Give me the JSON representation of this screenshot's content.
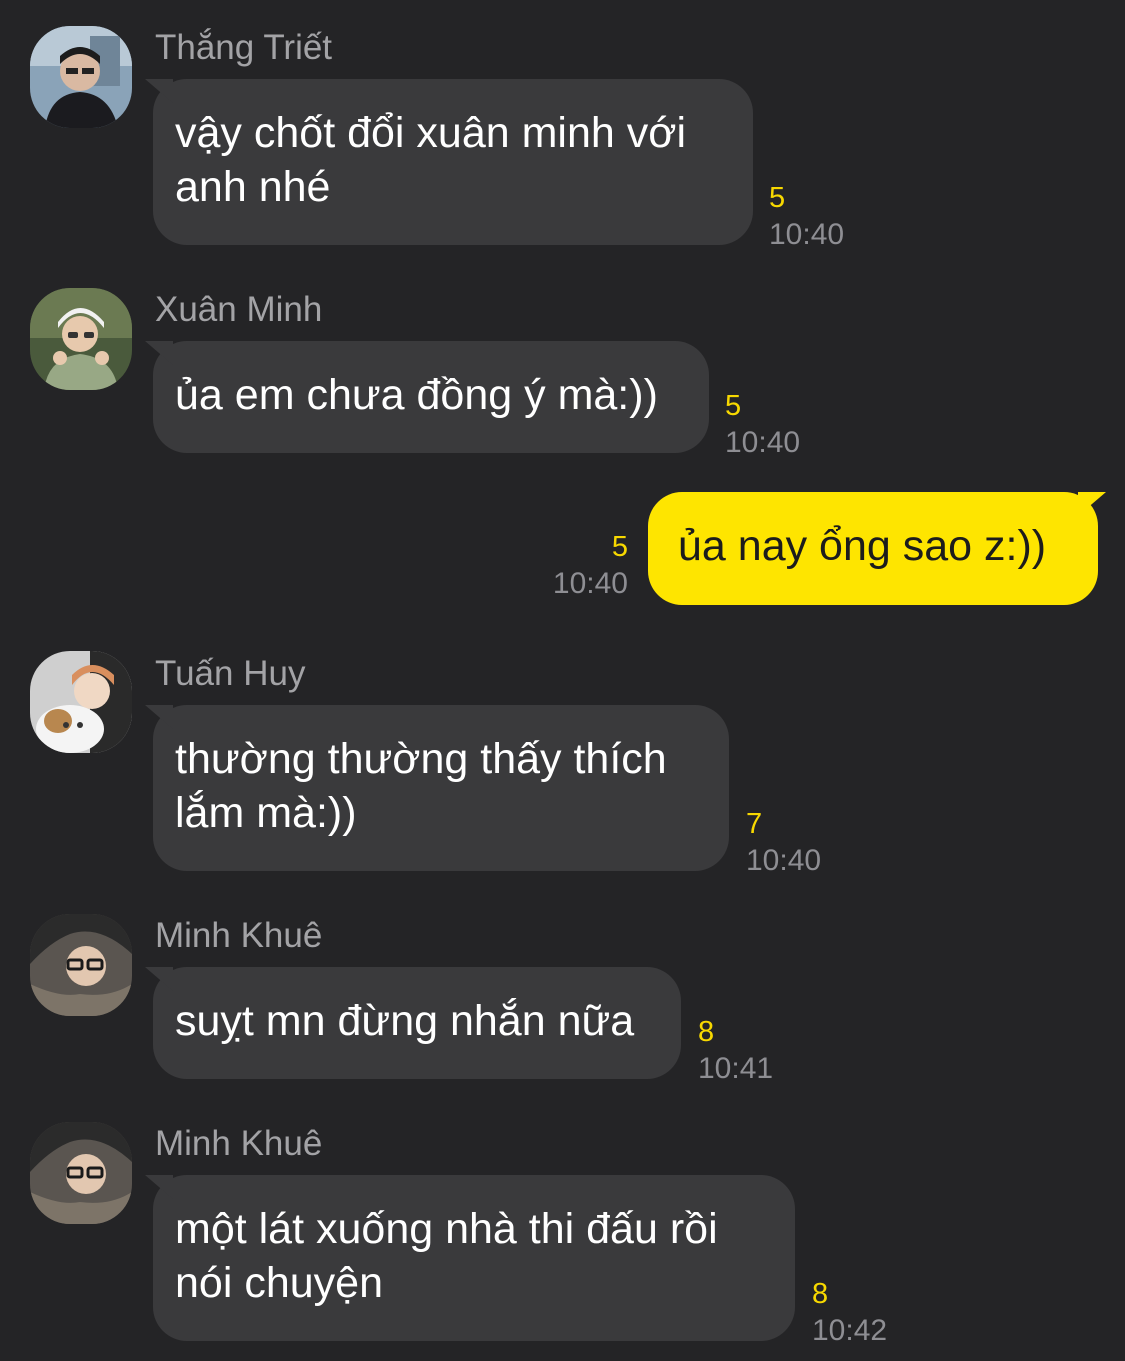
{
  "messages": [
    {
      "sender": "Thắng Triết",
      "avatar_icon": "avatar-thang-triet",
      "lines": [
        "vậy chốt đổi xuân minh với",
        "anh nhé"
      ],
      "unread": "5",
      "time": "10:40",
      "mine": false
    },
    {
      "sender": "Xuân Minh",
      "avatar_icon": "avatar-xuan-minh",
      "lines": [
        "ủa em chưa đồng ý mà:))"
      ],
      "unread": "5",
      "time": "10:40",
      "mine": false
    },
    {
      "sender": "",
      "lines": [
        "ủa nay ổng sao z:))"
      ],
      "unread": "5",
      "time": "10:40",
      "mine": true
    },
    {
      "sender": "Tuấn Huy",
      "avatar_icon": "avatar-tuan-huy",
      "lines": [
        "thường thường thấy thích",
        "lắm mà:))"
      ],
      "unread": "7",
      "time": "10:40",
      "mine": false
    },
    {
      "sender": "Minh Khuê",
      "avatar_icon": "avatar-minh-khue",
      "lines": [
        "suỵt mn đừng nhắn nữa"
      ],
      "unread": "8",
      "time": "10:41",
      "mine": false
    },
    {
      "sender": "Minh Khuê",
      "avatar_icon": "avatar-minh-khue",
      "lines": [
        "một lát xuống nhà thi đấu rồi",
        "nói chuyện"
      ],
      "unread": "8",
      "time": "10:42",
      "mine": false
    }
  ],
  "colors": {
    "background": "#242426",
    "bubble_other": "#3a3a3c",
    "bubble_mine": "#fee500",
    "unread": "#f7d800",
    "time": "#8e8e93",
    "sender": "#a3a3a6"
  }
}
